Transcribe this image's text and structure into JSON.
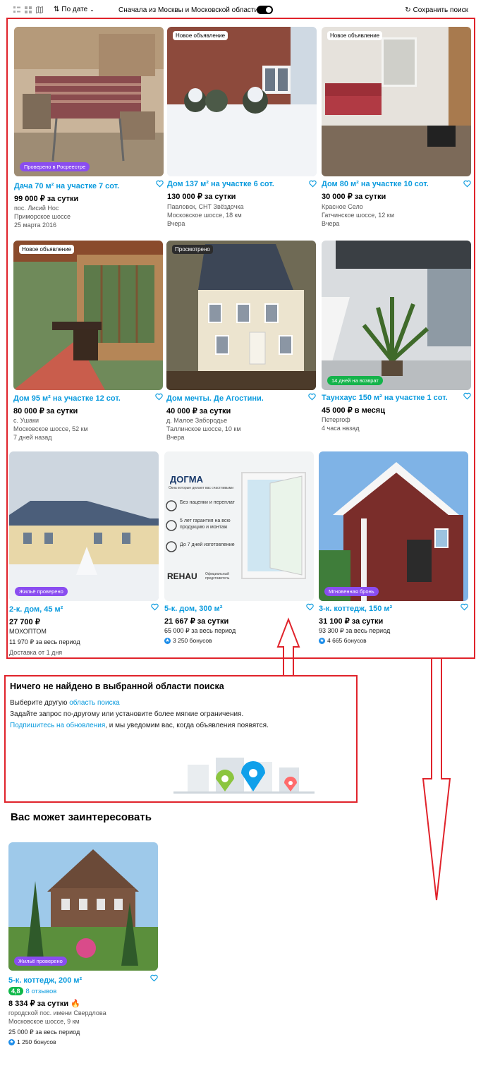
{
  "toolbar": {
    "sort_label": "По дате",
    "filter_label": "Сначала из Москвы и Московской области",
    "save_label": "Сохранить поиск"
  },
  "cards": [
    {
      "title": "Дача 70 м² на участке 7 сот.",
      "price": "99 000 ₽ за сутки",
      "line1": "пос. Лисий Нос",
      "line2": "Приморское шоссе",
      "line3": "25 марта 2016",
      "badge_bl": "Проверено в Росреестре",
      "badge_bl_color": "#8a4df0"
    },
    {
      "title": "Дом 137 м² на участке 6 сот.",
      "price": "130 000 ₽ за сутки",
      "line1": "Павловск, СНТ Звёздочка",
      "line2": "Московское шоссе, 18 км",
      "line3": "Вчера",
      "badge_tl": "Новое объявление"
    },
    {
      "title": "Дом 80 м² на участке 10 сот.",
      "price": "30 000 ₽ за сутки",
      "line1": "Красное Село",
      "line2": "Гатчинское шоссе, 12 км",
      "line3": "Вчера",
      "badge_tl": "Новое объявление"
    },
    {
      "title": "Дом 95 м² на участке 12 сот.",
      "price": "80 000 ₽ за сутки",
      "line1": "с. Ушаки",
      "line2": "Московское шоссе, 52 км",
      "line3": "7 дней назад",
      "badge_tl": "Новое объявление"
    },
    {
      "title": "Дом мечты. Де Агостини.",
      "price": "40 000 ₽ за сутки",
      "line1": "д. Малое Забородье",
      "line2": "Таллинское шоссе, 10 км",
      "line3": "Вчера",
      "badge_tl": "Просмотрено"
    },
    {
      "title": "Таунхаус 150 м² на участке 1 сот.",
      "price": "45 000 ₽ в месяц",
      "line1": "Петергоф",
      "line2": "4 часа назад",
      "badge_bl": "14 дней на возврат",
      "badge_bl_color": "#14b34a"
    },
    {
      "title": "2-к. дом, 45 м²",
      "price": "27 700 ₽",
      "line1": "МОХОПТОМ",
      "line2": "11 970 ₽ за весь период",
      "line3": "Доставка от 1 дня",
      "badge_bl": "Жильё проверено",
      "badge_bl_color": "#8a4df0"
    },
    {
      "title": "5-к. дом, 300 м²",
      "price": "21 667 ₽ за сутки",
      "line1": "65 000 ₽ за весь период",
      "bonus": "3 250 бонусов"
    },
    {
      "title": "3-к. коттедж, 150 м²",
      "price": "31 100 ₽ за сутки",
      "line1": "93 300 ₽ за весь период",
      "bonus": "4 665 бонусов",
      "badge_bl": "Мгновенная бронь",
      "badge_bl_color": "#8a4df0"
    }
  ],
  "ad": {
    "brand": "ДОГМА",
    "tagline": "Окна которые делают вас счастливыми",
    "f1": "Без наценки и переплат",
    "f2": "5 лет гарантия на всю продукцию и монтаж",
    "f3": "До 7 дней изготовление",
    "partner": "REHAU",
    "partner_note": "Официальный представитель"
  },
  "empty": {
    "title": "Ничего не найдено в выбранной области поиска",
    "p1_prefix": "Выберите другую ",
    "p1_link": "область поиска",
    "p2": "Задайте запрос по-другому или установите более мягкие ограничения.",
    "p3_link": "Подпишитесь на обновления",
    "p3_suffix": ", и мы уведомим вас, когда объявления появятся."
  },
  "recommend": {
    "section_title": "Вас может заинтересовать",
    "title": "5-к. коттедж, 200 м²",
    "rating": "4,8",
    "reviews": "8 отзывов",
    "price": "8 334 ₽ за сутки",
    "line1": "городской пос. имени Свердлова",
    "line2": "Московское шоссе, 9 км",
    "line3": "25 000 ₽ за весь период",
    "bonus": "1 250 бонусов",
    "badge_bl": "Жильё проверено"
  },
  "colors": {
    "accent": "#0b9bde",
    "annotation": "#e0232b",
    "rating": "#10b84a"
  }
}
